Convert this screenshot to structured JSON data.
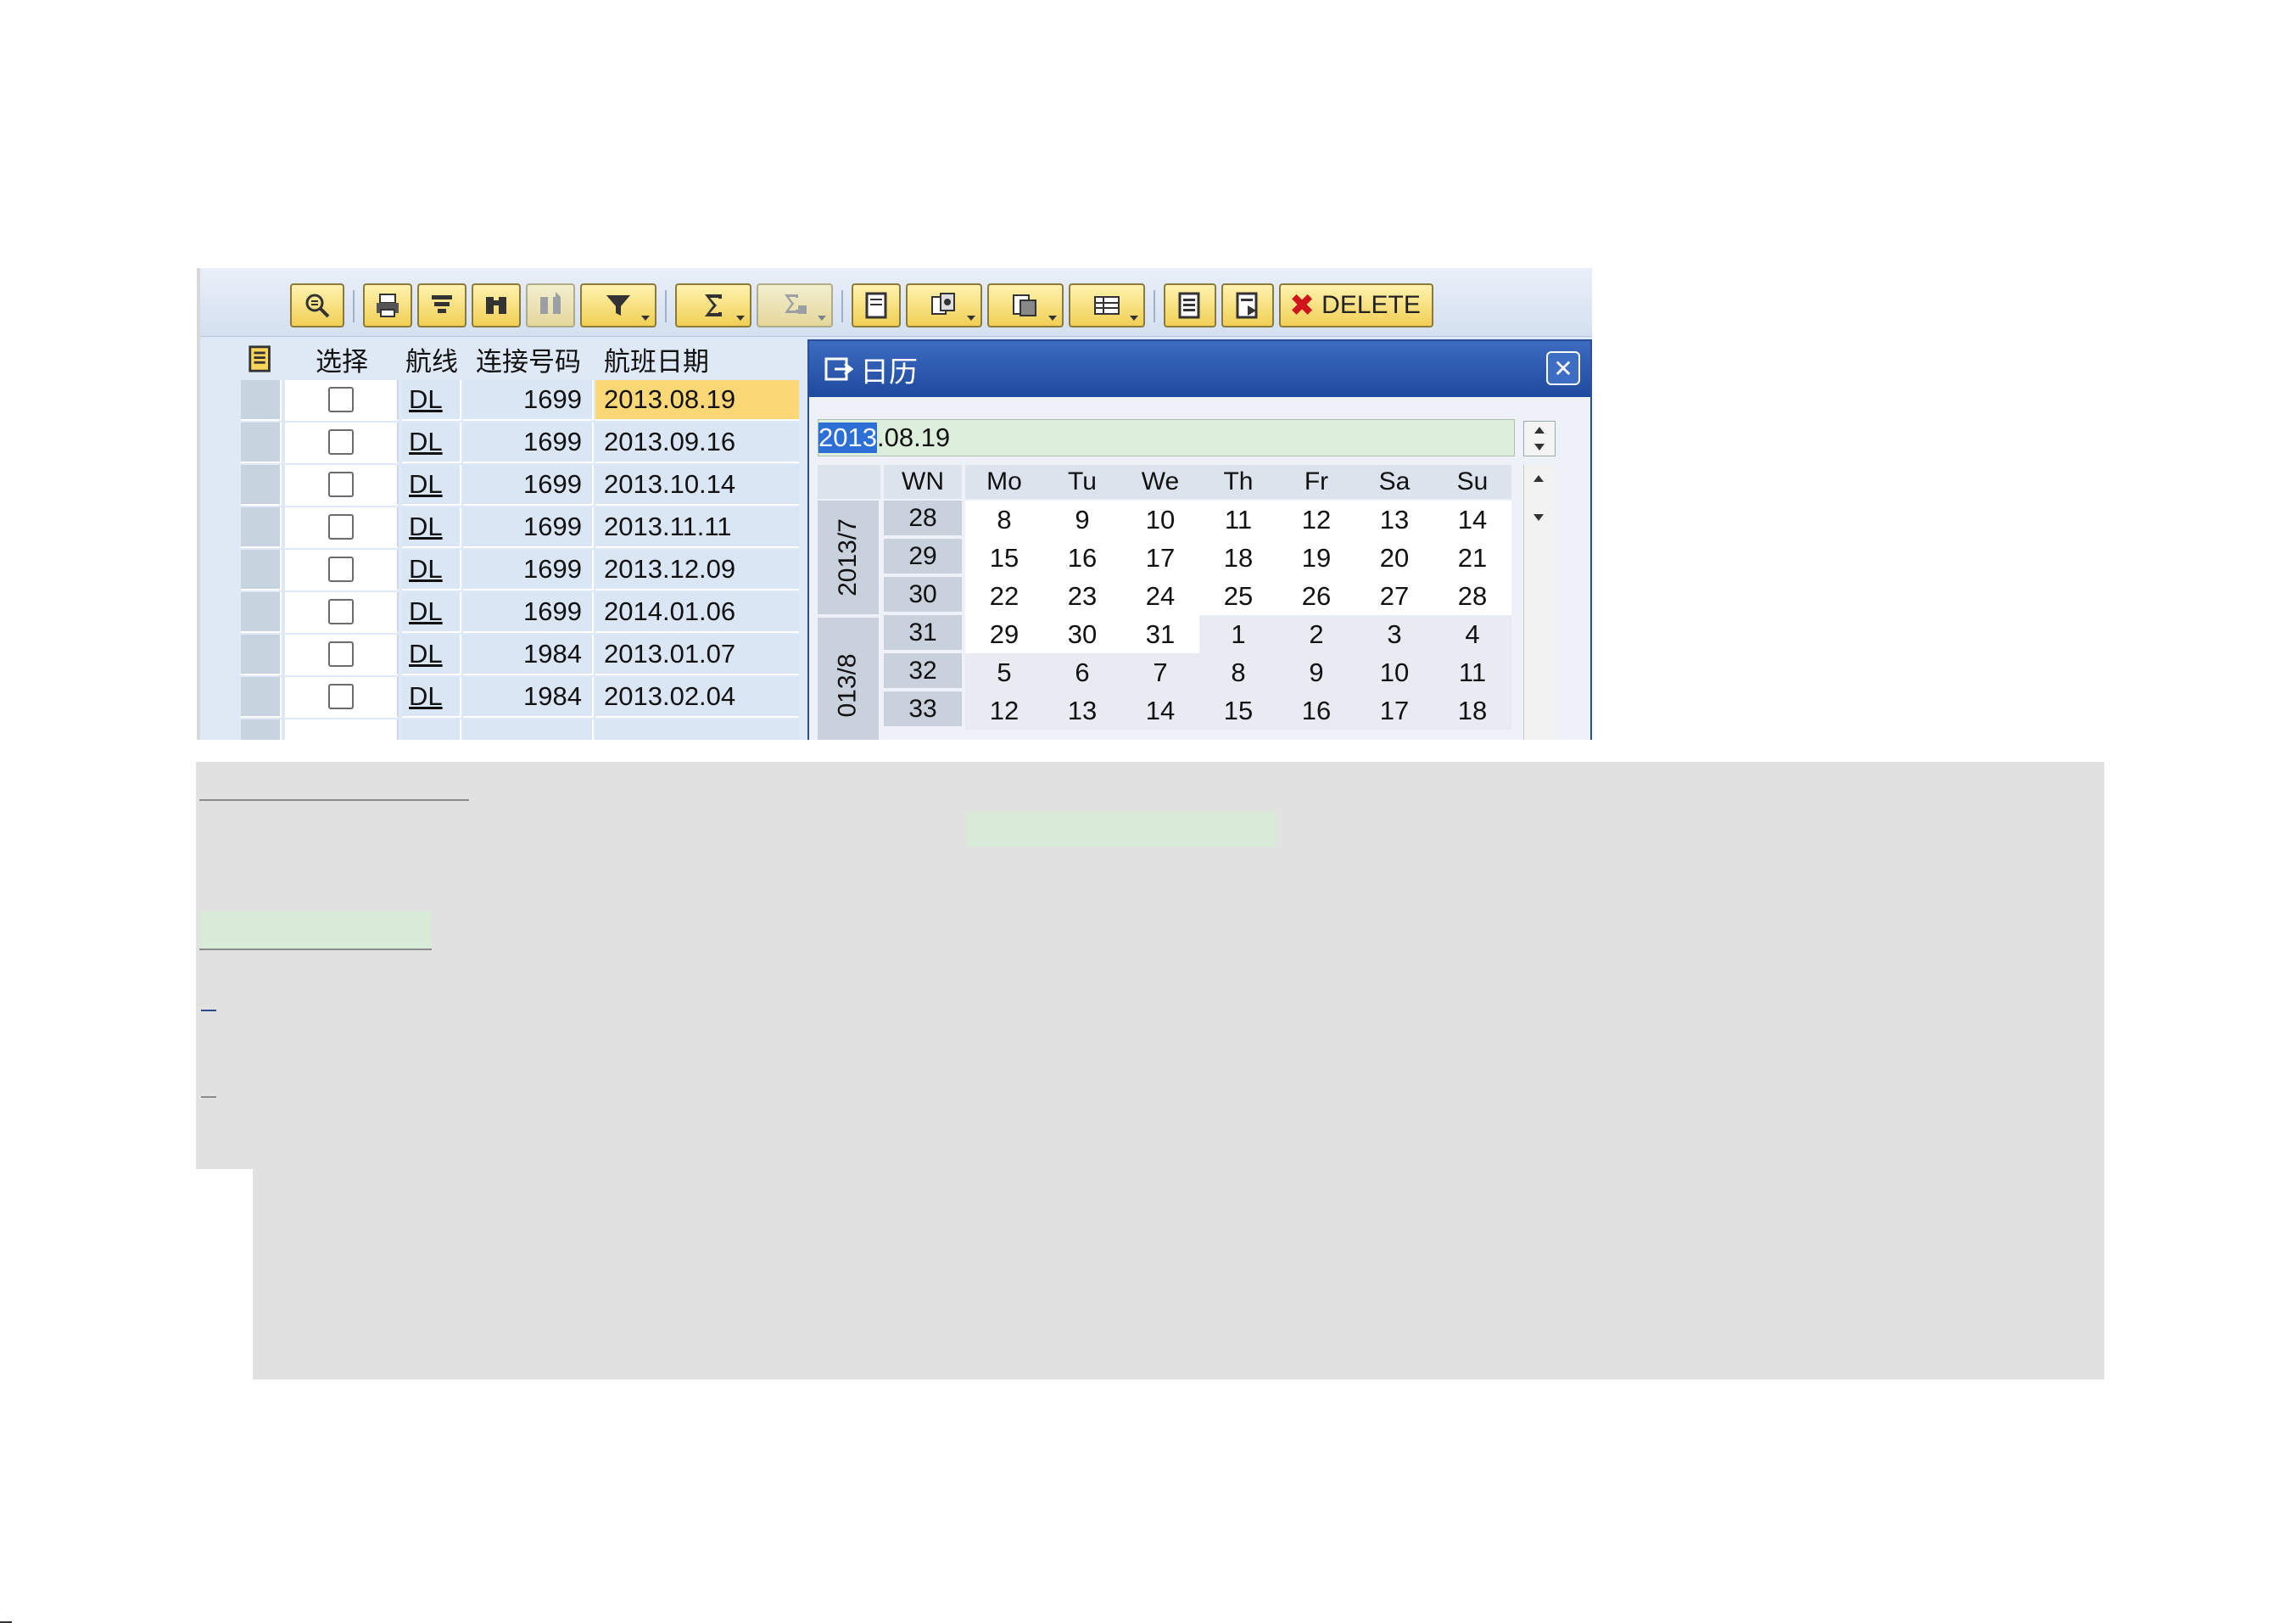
{
  "toolbar": {
    "buttons": [
      {
        "name": "details-icon"
      },
      {
        "name": "print-icon"
      },
      {
        "name": "sort-icon"
      },
      {
        "name": "find-icon"
      },
      {
        "name": "find-next-icon"
      },
      {
        "name": "filter-icon"
      },
      {
        "name": "sum-icon"
      },
      {
        "name": "subtotal-icon"
      },
      {
        "name": "print-preview-icon"
      },
      {
        "name": "export-icon"
      },
      {
        "name": "views-icon"
      },
      {
        "name": "layout-icon"
      },
      {
        "name": "append-row-icon"
      },
      {
        "name": "insert-row-icon"
      }
    ],
    "delete_label": "DELETE"
  },
  "table": {
    "headers": {
      "select": "选择",
      "route": "航线",
      "connection": "连接号码",
      "date": "航班日期"
    },
    "rows": [
      {
        "route": "DL",
        "connection": "1699",
        "date": "2013.08.19"
      },
      {
        "route": "DL",
        "connection": "1699",
        "date": "2013.09.16"
      },
      {
        "route": "DL",
        "connection": "1699",
        "date": "2013.10.14"
      },
      {
        "route": "DL",
        "connection": "1699",
        "date": "2013.11.11"
      },
      {
        "route": "DL",
        "connection": "1699",
        "date": "2013.12.09"
      },
      {
        "route": "DL",
        "connection": "1699",
        "date": "2014.01.06"
      },
      {
        "route": "DL",
        "connection": "1984",
        "date": "2013.01.07"
      },
      {
        "route": "DL",
        "connection": "1984",
        "date": "2013.02.04"
      }
    ],
    "highlight_color": "#fbd775"
  },
  "calendar": {
    "title": "日历",
    "field_selected": "2013",
    "field_rest": ".08.19",
    "headers": [
      "WN",
      "Mo",
      "Tu",
      "We",
      "Th",
      "Fr",
      "Sa",
      "Su"
    ],
    "month_labels": [
      "2013/7",
      "013/8"
    ],
    "weeks": [
      {
        "wn": "28",
        "days": [
          "8",
          "9",
          "10",
          "11",
          "12",
          "13",
          "14"
        ]
      },
      {
        "wn": "29",
        "days": [
          "15",
          "16",
          "17",
          "18",
          "19",
          "20",
          "21"
        ]
      },
      {
        "wn": "30",
        "days": [
          "22",
          "23",
          "24",
          "25",
          "26",
          "27",
          "28"
        ]
      },
      {
        "wn": "31",
        "days": [
          "29",
          "30",
          "31",
          "1",
          "2",
          "3",
          "4"
        ]
      },
      {
        "wn": "32",
        "days": [
          "5",
          "6",
          "7",
          "8",
          "9",
          "10",
          "11"
        ]
      },
      {
        "wn": "33",
        "days": [
          "12",
          "13",
          "14",
          "15",
          "16",
          "17",
          "18"
        ]
      }
    ],
    "accent": "#2a4f97"
  }
}
